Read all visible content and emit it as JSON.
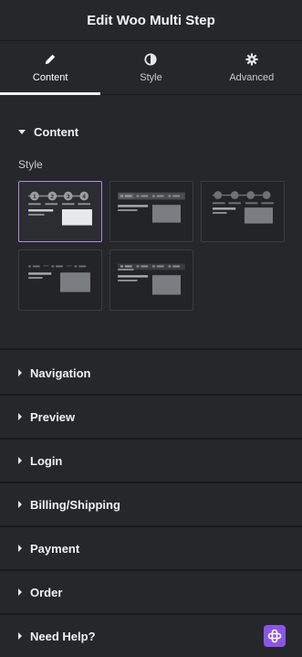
{
  "header": {
    "title": "Edit Woo Multi Step"
  },
  "tabs": [
    {
      "label": "Content",
      "icon": "pencil-icon",
      "active": true
    },
    {
      "label": "Style",
      "icon": "contrast-icon",
      "active": false
    },
    {
      "label": "Advanced",
      "icon": "gear-icon",
      "active": false
    }
  ],
  "content_section": {
    "title": "Content",
    "style_label": "Style",
    "step_numbers": [
      "1",
      "2",
      "3",
      "4"
    ]
  },
  "accordions": [
    {
      "title": "Navigation"
    },
    {
      "title": "Preview"
    },
    {
      "title": "Login"
    },
    {
      "title": "Billing/Shipping"
    },
    {
      "title": "Payment"
    },
    {
      "title": "Order"
    },
    {
      "title": "Need Help?"
    }
  ],
  "colors": {
    "accent": "#b08ce0",
    "help_button": "#8a56e8"
  }
}
